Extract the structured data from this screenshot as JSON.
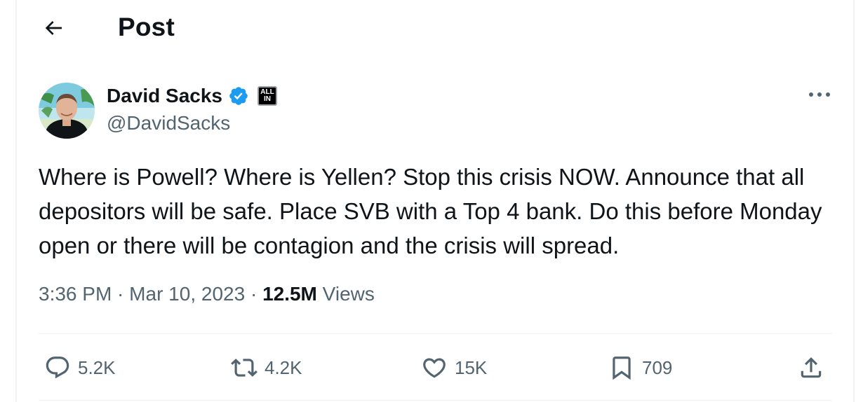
{
  "header": {
    "title": "Post",
    "back_icon": "arrow-left-icon"
  },
  "tweet": {
    "author": {
      "display_name": "David Sacks",
      "handle": "@DavidSacks",
      "verified_icon": "verified-badge-icon",
      "affiliate_badge": {
        "line1": "ALL",
        "line2": "IN"
      }
    },
    "text": "Where is Powell? Where is Yellen? Stop this crisis NOW. Announce that all depositors will be safe. Place SVB with a Top 4 bank. Do this before Monday open or there will be contagion and the crisis will spread.",
    "time": "3:36 PM",
    "separator": " · ",
    "date": "Mar 10, 2023",
    "views_count": "12.5M",
    "views_label": "Views"
  },
  "actions": {
    "reply": {
      "icon": "reply-icon",
      "count": "5.2K"
    },
    "repost": {
      "icon": "repost-icon",
      "count": "4.2K"
    },
    "like": {
      "icon": "heart-icon",
      "count": "15K"
    },
    "bookmark": {
      "icon": "bookmark-icon",
      "count": "709"
    },
    "share": {
      "icon": "share-icon"
    }
  },
  "colors": {
    "text_primary": "#0f1419",
    "text_secondary": "#536471",
    "verified": "#1d9bf0",
    "divider": "#eff3f4"
  }
}
